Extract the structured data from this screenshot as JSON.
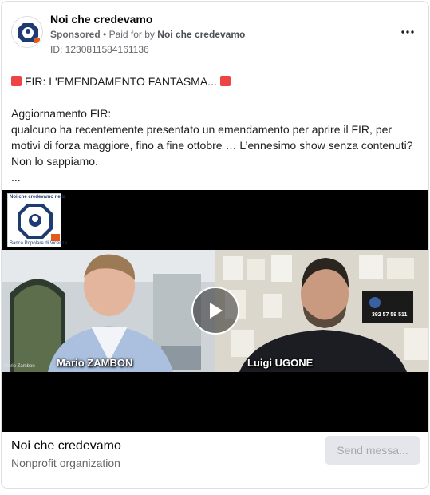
{
  "header": {
    "page_name": "Noi che credevamo",
    "sponsored": "Sponsored",
    "separator": "•",
    "paid_for_by": "Paid for by",
    "paid_by_name": "Noi che credevamo",
    "ad_id": "ID: 1230811584161136",
    "more_icon": "more-horizontal-icon"
  },
  "post": {
    "headline": "FIR: L'EMENDAMENTO FANTASMA...",
    "line1": "Aggiornamento FIR:",
    "line2": "qualcuno ha recentemente presentato un emendamento per aprire il FIR, per motivi di forza maggiore, fino a fine ottobre … L’ennesimo show senza contenuti?",
    "line3": "Non lo sappiamo.",
    "line4": "..."
  },
  "media": {
    "logo_top_text": "Noi che credevamo nella",
    "logo_bottom_text": "Banca Popolare di Vicenza",
    "left_speaker": "Mario ZAMBON",
    "left_small_caption": "Mario Zambon",
    "right_speaker": "Luigi UGONE",
    "poster_phone": "392 57 59 511",
    "play_icon": "play-icon"
  },
  "footer": {
    "name": "Noi che credevamo",
    "category": "Nonprofit organization",
    "cta_label": "Send messa..."
  },
  "colors": {
    "accent_red": "#ef4444",
    "logo_blue": "#1f3b73",
    "muted_text": "#65676b"
  }
}
